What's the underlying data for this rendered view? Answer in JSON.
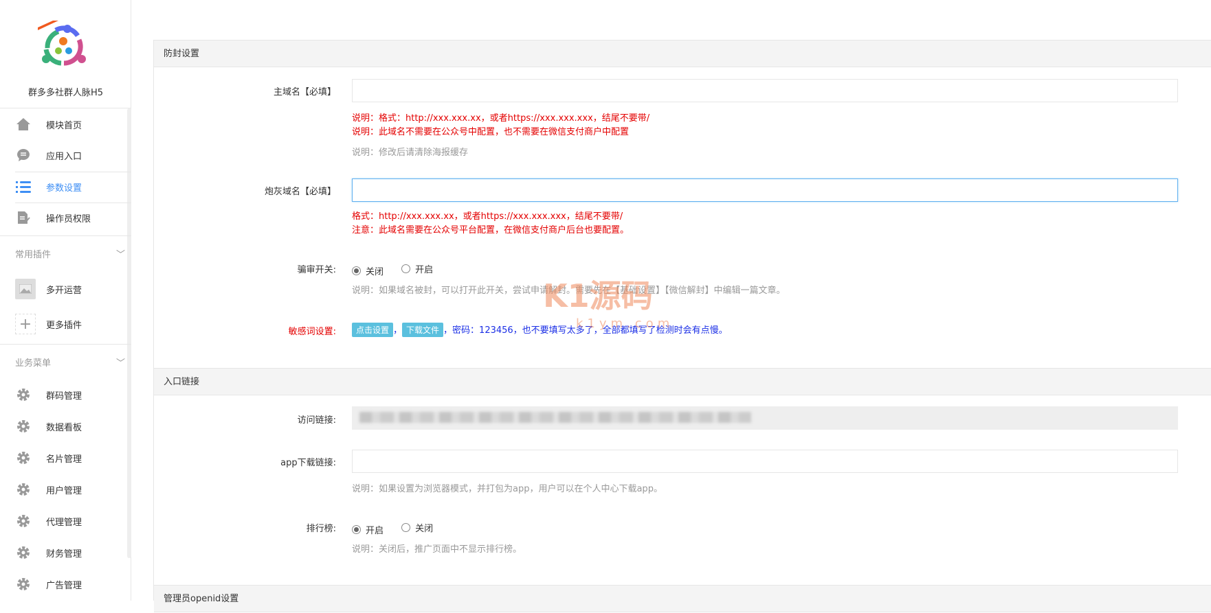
{
  "sidebar": {
    "app_title": "群多多社群人脉H5",
    "logo_badge": "群多多",
    "items": [
      {
        "label": "模块首页",
        "icon": "home-icon"
      },
      {
        "label": "应用入口",
        "icon": "chat-icon"
      },
      {
        "label": "参数设置",
        "icon": "list-icon"
      },
      {
        "label": "操作员权限",
        "icon": "edit-doc-icon"
      }
    ],
    "groups": [
      {
        "label": "常用插件",
        "items": [
          {
            "label": "多开运营",
            "icon": "image-icon"
          },
          {
            "label": "更多插件",
            "icon": "plus-icon"
          }
        ]
      },
      {
        "label": "业务菜单",
        "items": [
          {
            "label": "群码管理"
          },
          {
            "label": "数据看板"
          },
          {
            "label": "名片管理"
          },
          {
            "label": "用户管理"
          },
          {
            "label": "代理管理"
          },
          {
            "label": "财务管理"
          },
          {
            "label": "广告管理"
          }
        ]
      }
    ]
  },
  "sections": {
    "anti_block": {
      "title": "防封设置",
      "main_domain": {
        "label": "主域名【必填】",
        "value": "",
        "note1": "说明：格式：http://xxx.xxx.xx，或者https://xxx.xxx.xxx，结尾不要带/",
        "note2": "说明：此域名不需要在公众号中配置，也不需要在微信支付商户中配置",
        "note3": "说明：修改后请清除海报缓存"
      },
      "cannon_domain": {
        "label": "炮灰域名【必填】",
        "value": "",
        "note1": "格式：http://xxx.xxx.xx，或者https://xxx.xxx.xxx，结尾不要带/",
        "note2": "注意：此域名需要在公众号平台配置，在微信支付商户后台也要配置。"
      },
      "review_switch": {
        "label": "骗审开关:",
        "options": [
          "关闭",
          "开启"
        ],
        "selected": "关闭",
        "note": "说明：如果域名被封，可以打开此开关，尝试申请解封。需要先在【基础设置】【微信解封】中编辑一篇文章。"
      },
      "sensitive": {
        "label": "敏感词设置:",
        "btn_set": "点击设置",
        "btn_download": "下载文件",
        "comma": "，",
        "note": "，密码：123456，也不要填写太多了，全部都填写了检测时会有点慢。"
      }
    },
    "entry": {
      "title": "入口链接",
      "visit_link": {
        "label": "访问链接:"
      },
      "app_link": {
        "label": "app下载链接:",
        "value": "",
        "note": "说明：如果设置为浏览器模式，并打包为app，用户可以在个人中心下载app。"
      },
      "ranking": {
        "label": "排行榜:",
        "options": [
          "开启",
          "关闭"
        ],
        "selected": "开启",
        "note": "说明：关闭后，推广页面中不显示排行榜。"
      }
    },
    "admin": {
      "title": "管理员openid设置"
    }
  },
  "watermark": {
    "brand": "K1源码",
    "url": "k1ym.com"
  }
}
